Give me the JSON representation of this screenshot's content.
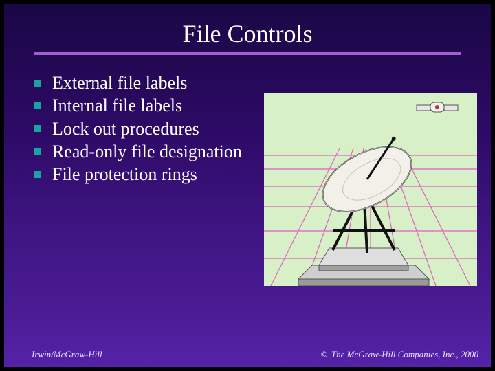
{
  "title": "File Controls",
  "bullets": [
    "External file labels",
    "Internal file labels",
    "Lock out procedures",
    "Read-only file designation",
    "File protection rings"
  ],
  "footer": {
    "left": "Irwin/McGraw-Hill",
    "right_symbol": "©",
    "right_text": " The McGraw-Hill Companies, Inc., 2000"
  }
}
